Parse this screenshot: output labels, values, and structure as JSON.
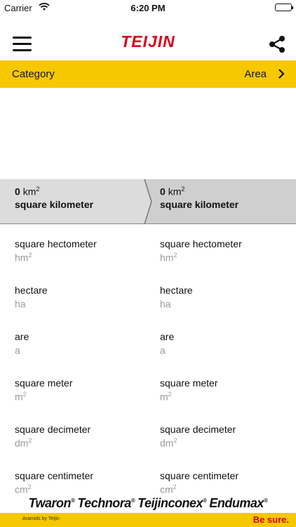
{
  "status_bar": {
    "carrier": "Carrier",
    "time": "6:20 PM"
  },
  "header": {
    "logo_text": "TEIJIN",
    "menu_icon": "hamburger-menu-icon",
    "share_icon": "share-icon"
  },
  "category_bar": {
    "label": "Category",
    "value": "Area"
  },
  "selected": {
    "left": {
      "value": "0",
      "symbol": "km",
      "power": "2",
      "name": "square kilometer"
    },
    "right": {
      "value": "0",
      "symbol": "km",
      "power": "2",
      "name": "square kilometer"
    }
  },
  "units": [
    {
      "name": "square hectometer",
      "symbol": "hm",
      "power": "2"
    },
    {
      "name": "hectare",
      "symbol": "ha",
      "power": ""
    },
    {
      "name": "are",
      "symbol": "a",
      "power": ""
    },
    {
      "name": "square meter",
      "symbol": "m",
      "power": "2"
    },
    {
      "name": "square decimeter",
      "symbol": "dm",
      "power": "2"
    },
    {
      "name": "square centimeter",
      "symbol": "cm",
      "power": "2"
    }
  ],
  "brands": [
    "Twaron",
    "Technora",
    "Teijinconex",
    "Endumax"
  ],
  "footer": {
    "aramids": "Aramids by Teijin",
    "tagline": "Be sure."
  },
  "colors": {
    "accent_yellow": "#f5c800",
    "brand_red": "#d8001a",
    "selected_gray_left": "#dcdcdc",
    "selected_gray_right": "#cfcfcf"
  }
}
